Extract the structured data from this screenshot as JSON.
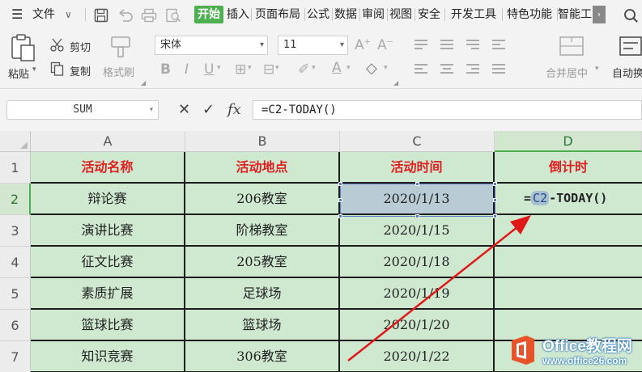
{
  "menubar": {
    "file_label": "文件",
    "tabs": [
      "开始",
      "插入",
      "页面布局",
      "公式",
      "数据",
      "审阅",
      "视图",
      "安全",
      "开发工具",
      "特色功能",
      "智能工"
    ],
    "active_tab": "开始",
    "more_label": "›",
    "accent_color": "#4caf50"
  },
  "ribbon": {
    "paste_label": "粘贴",
    "cut_label": "剪切",
    "copy_label": "复制",
    "format_painter_label": "格式刷",
    "font_name": "宋体",
    "font_size": "11",
    "merge_center_label": "合并居中",
    "auto_wrap_label": "自动换"
  },
  "formula_bar": {
    "name_box": "SUM",
    "formula": "=C2-TODAY()"
  },
  "sheet": {
    "col_headers": [
      "A",
      "B",
      "C",
      "D"
    ],
    "row_headers": [
      "1",
      "2",
      "3",
      "4",
      "5",
      "6",
      "7"
    ],
    "header_row": [
      "活动名称",
      "活动地点",
      "活动时间",
      "倒计时"
    ],
    "rows": [
      [
        "辩论赛",
        "206教室",
        "2020/1/13"
      ],
      [
        "演讲比赛",
        "阶梯教室",
        "2020/1/15"
      ],
      [
        "征文比赛",
        "205教室",
        "2020/1/18"
      ],
      [
        "素质扩展",
        "足球场",
        "2020/1/19"
      ],
      [
        "篮球比赛",
        "篮球场",
        "2020/1/20"
      ],
      [
        "知识竞赛",
        "306教室",
        "2020/1/22"
      ]
    ],
    "editing_cell": {
      "prefix": "=",
      "ref": "C2",
      "suffix": "-TODAY()"
    },
    "header_text_color": "#e02020",
    "cell_fill_color": "#cfe8d0"
  },
  "watermark": {
    "name": "Office教程网",
    "url": "www.office26.com"
  }
}
